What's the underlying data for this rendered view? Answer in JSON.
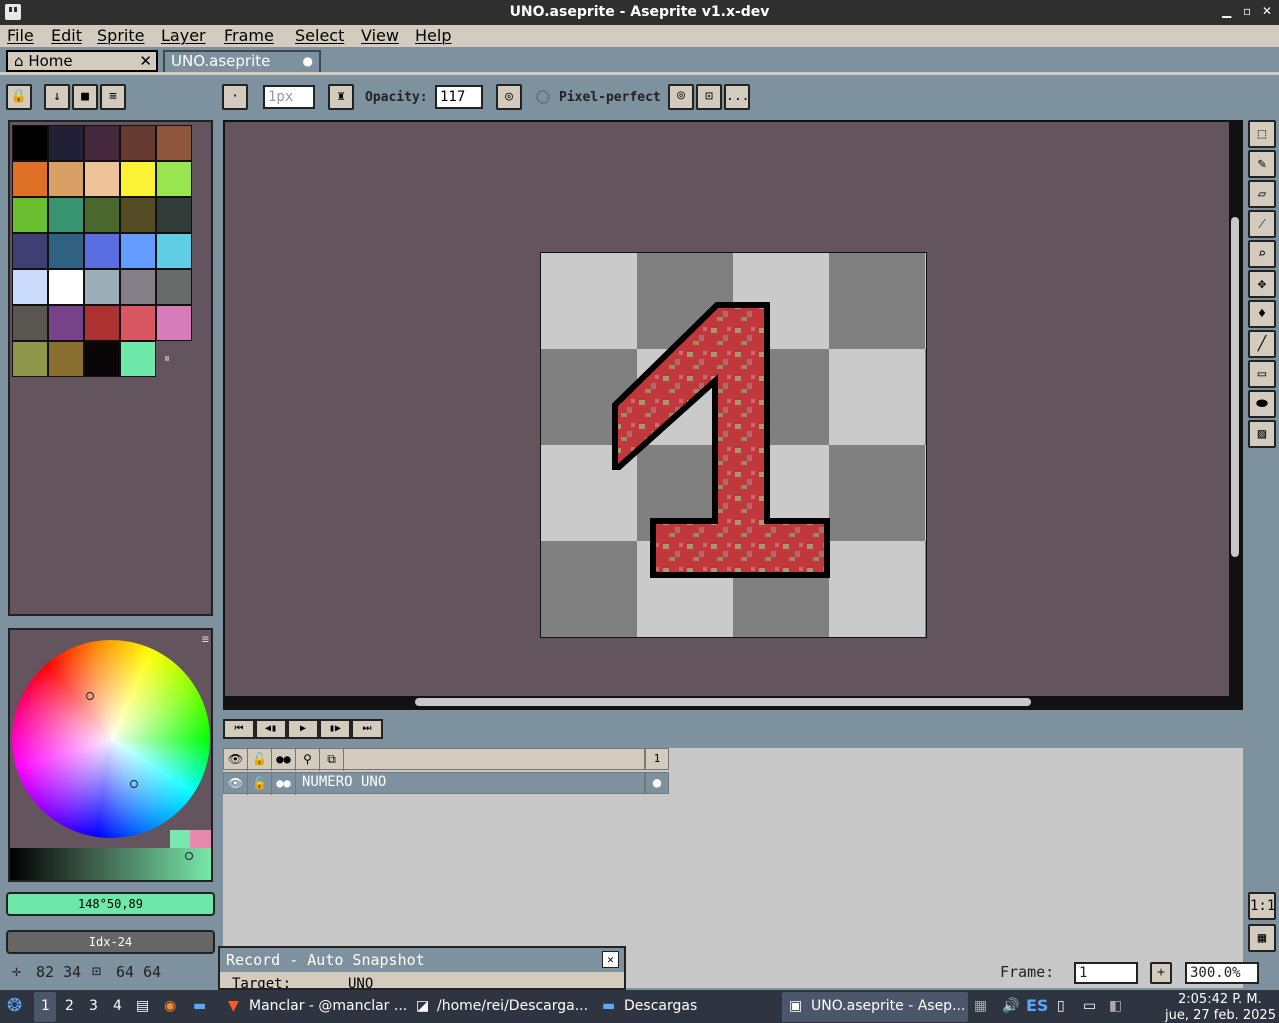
{
  "window": {
    "title": "UNO.aseprite - Aseprite v1.x-dev"
  },
  "menu": [
    "File",
    "Edit",
    "Sprite",
    "Layer",
    "Frame",
    "Select",
    "View",
    "Help"
  ],
  "tabs": [
    {
      "label": "Home",
      "close": "✕"
    },
    {
      "label": "UNO.aseprite",
      "close": "●"
    }
  ],
  "toolbar": {
    "brush_size": "1px",
    "opacity_label": "Opacity:",
    "opacity_value": "117",
    "pixel_perfect_label": "Pixel-perfect",
    "more": "..."
  },
  "palette": {
    "colors": [
      "#000000",
      "#222034",
      "#45283c",
      "#663931",
      "#8f563b",
      "#df7126",
      "#d9a066",
      "#eec39a",
      "#fbf236",
      "#99e550",
      "#6abe30",
      "#37946e",
      "#4b692f",
      "#524b24",
      "#323c39",
      "#3f3f74",
      "#306082",
      "#5b6ee1",
      "#639bff",
      "#5fcde4",
      "#cbdbfc",
      "#ffffff",
      "#9badb7",
      "#847e87",
      "#696a6a",
      "#595652",
      "#76428a",
      "#ac3232",
      "#d95763",
      "#d77bba",
      "#8f974a",
      "#8a6f30",
      "#0b0606",
      "#6ee8a8"
    ]
  },
  "color_bar": {
    "fg_value": "148°50,89",
    "index_value": "Idx-24"
  },
  "canvas": {
    "sprite_glyph": "1"
  },
  "playback": [
    "⏮",
    "◀▮",
    "▶",
    "▮▶",
    "⏭"
  ],
  "layers": {
    "frame_header": "1",
    "rows": [
      {
        "name": "NUMERO UNO",
        "cel": "●"
      }
    ]
  },
  "record": {
    "title": "Record - Auto Snapshot",
    "target_label": "Target:",
    "target_value": "UNO"
  },
  "status": {
    "pos": "82 34",
    "size": "64 64",
    "frame_label": "Frame:",
    "frame_value": "1",
    "zoom_value": "300.0%"
  },
  "tools": [
    "marquee-icon",
    "pencil-icon",
    "eraser-icon",
    "eyedropper-icon",
    "zoom-icon",
    "move-icon",
    "fill-icon",
    "line-icon",
    "rectangle-icon",
    "blob-icon",
    "blur-icon"
  ],
  "zoom_buttons": [
    "1:1",
    "▦"
  ],
  "taskbar": {
    "workspaces": [
      "1",
      "2",
      "3",
      "4"
    ],
    "windows": [
      "Manclar - @manclar ...",
      "/home/rei/Descarga...",
      "Descargas",
      "UNO.aseprite - Asep..."
    ],
    "lang": "ES",
    "time": "2:05:42 P. M.",
    "date": "jue, 27 feb. 2025"
  }
}
